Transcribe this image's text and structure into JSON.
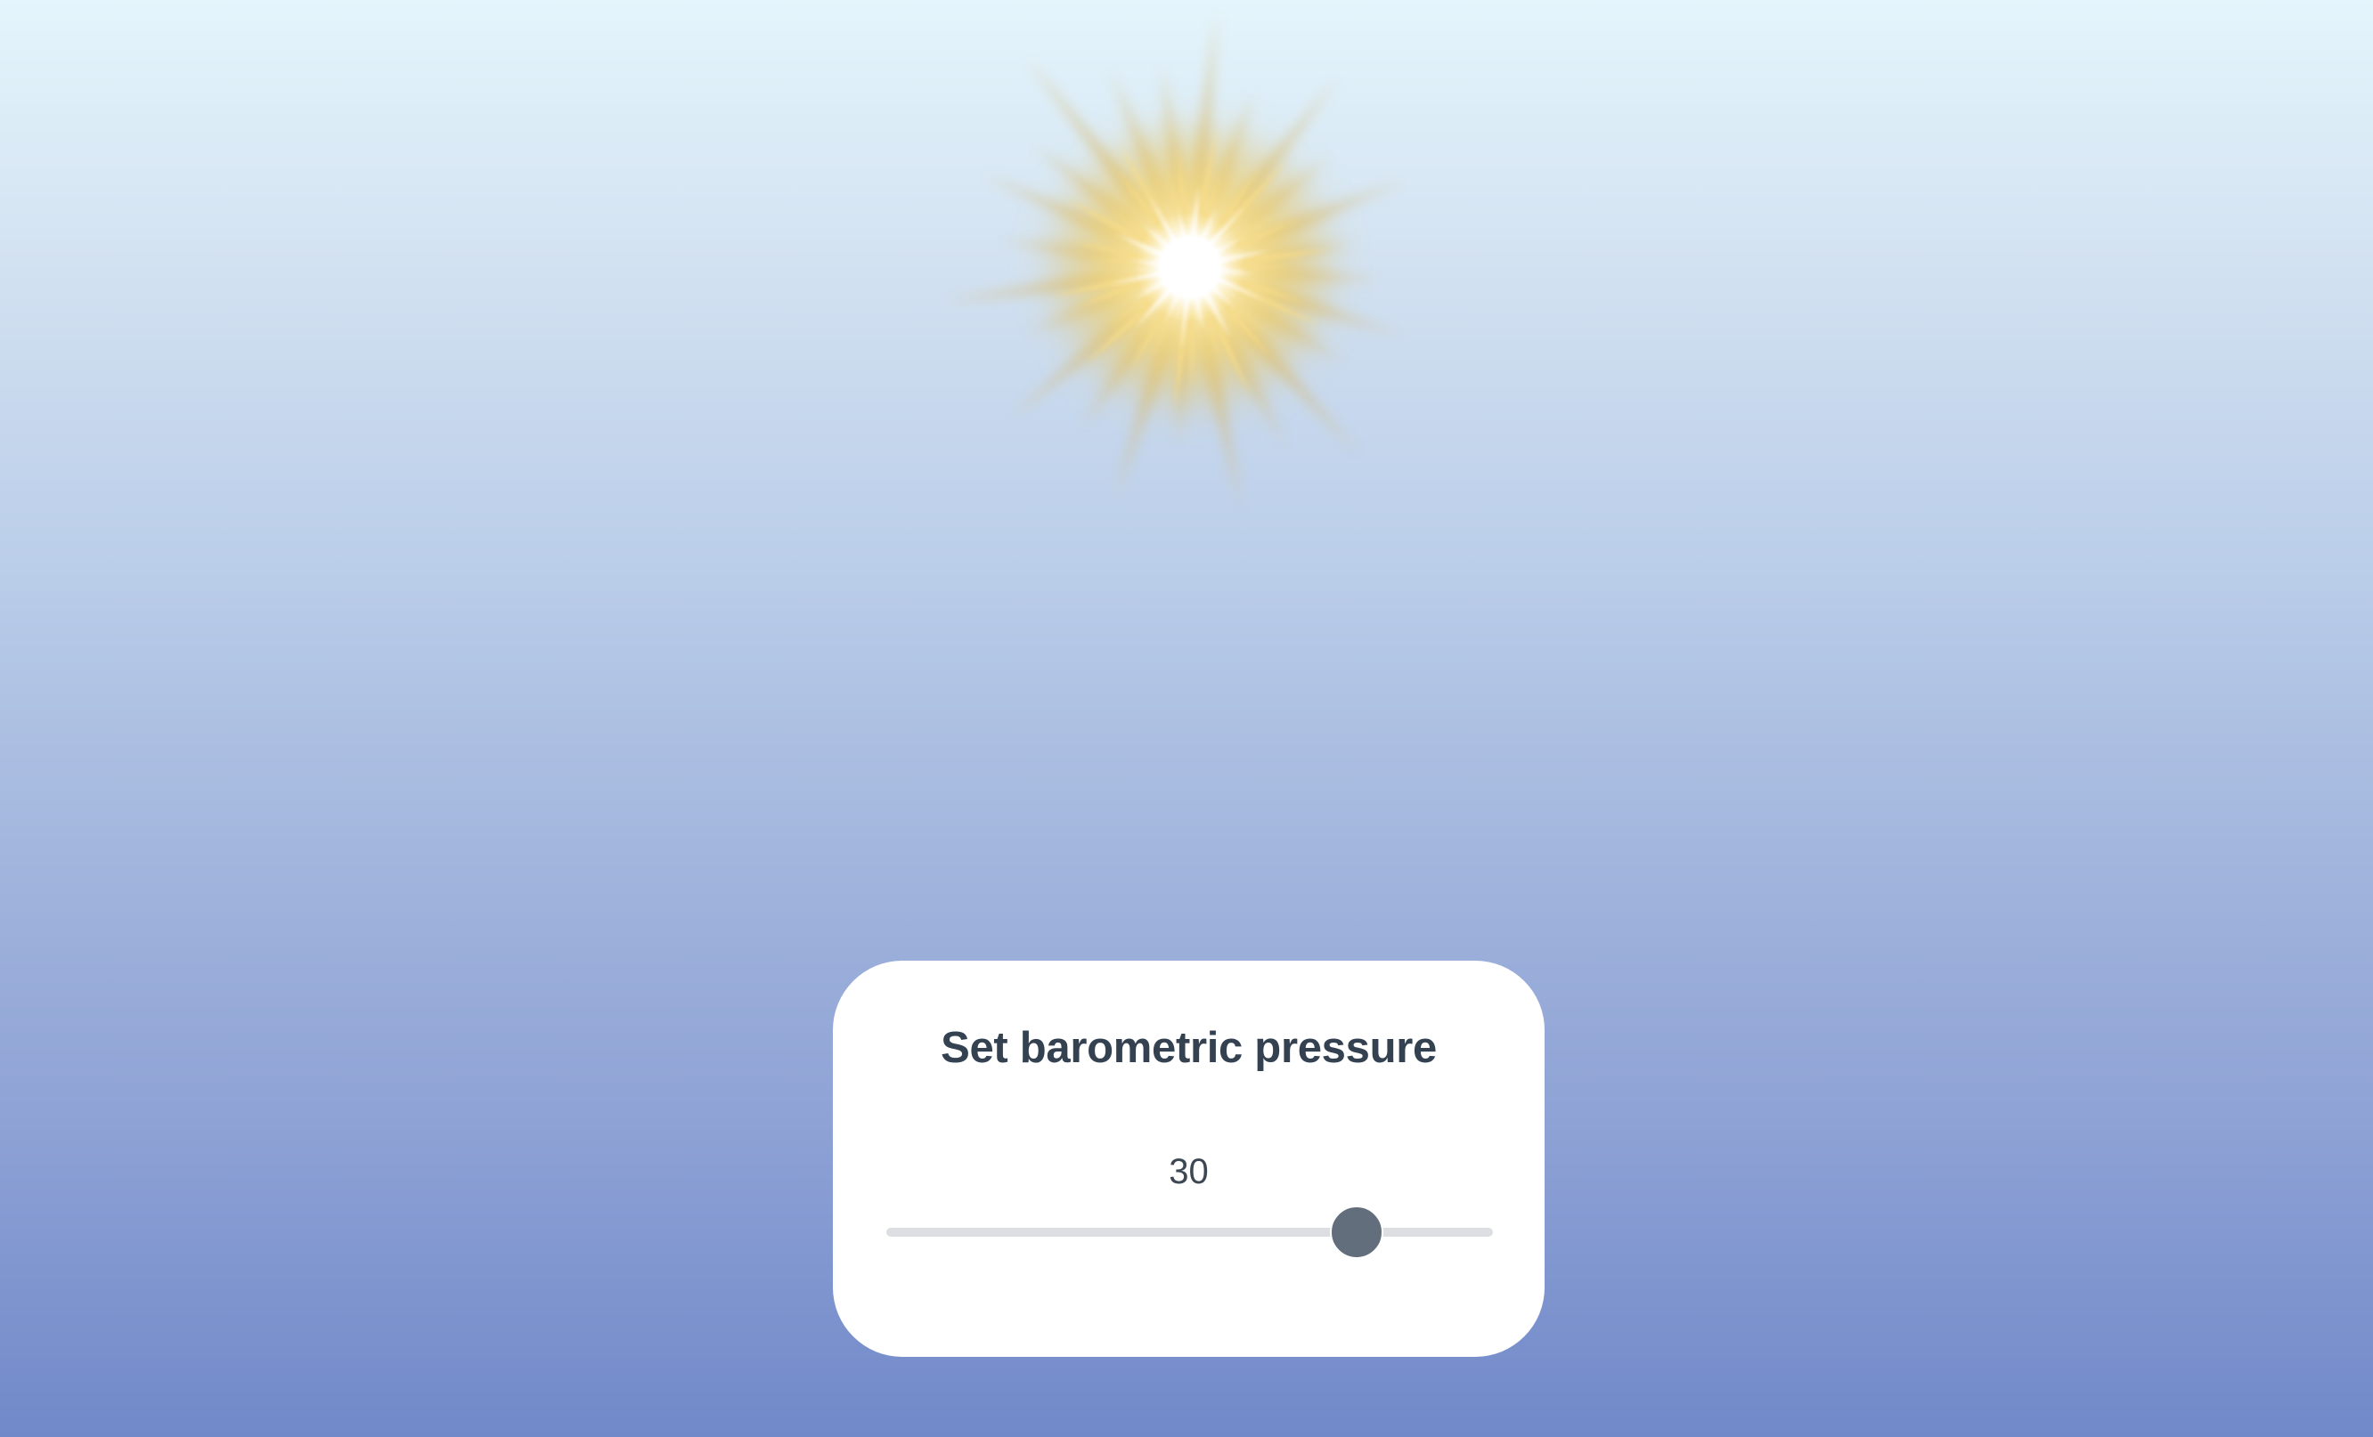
{
  "sky": {
    "colors": {
      "top": "#e4f5fc",
      "bottom": "#7189c9",
      "sun_core": "#ffffff",
      "sun_glow": "#f3cf5a"
    },
    "sun_icon": "sun-icon"
  },
  "panel": {
    "title": "Set barometric pressure",
    "value": "30",
    "slider": {
      "value_fraction": 0.775
    },
    "colors": {
      "card": "#ffffff",
      "title": "#334150",
      "track": "#dcdee2",
      "thumb": "#626e7b"
    }
  }
}
